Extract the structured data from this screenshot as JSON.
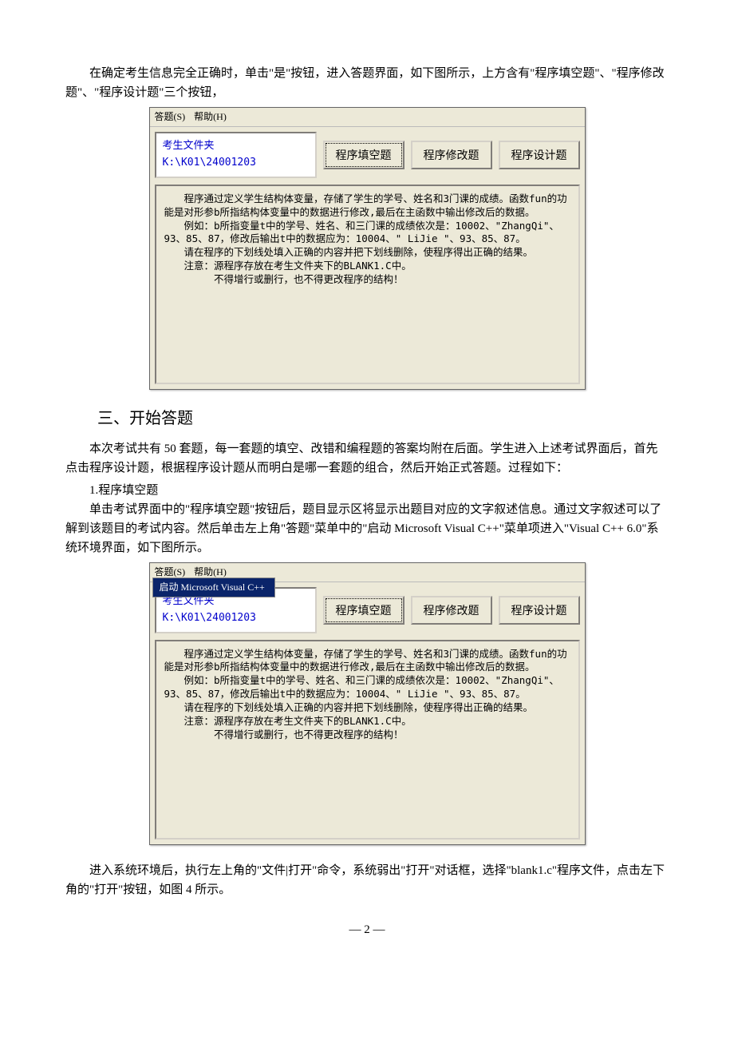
{
  "intro1": "在确定考生信息完全正确时，单击\"是\"按钮，进入答题界面，如下图所示，上方含有\"程序填空题\"、\"程序修改题\"、\"程序设计题\"三个按钮，",
  "menu": {
    "answer": "答题(S)",
    "help": "帮助(H)",
    "dropdown_label": "启动 Microsoft Visual C++"
  },
  "toolbar": {
    "path_label": "考生文件夹 K:\\K01\\24001203",
    "btn_fill": "程序填空题",
    "btn_modify": "程序修改题",
    "btn_design": "程序设计题"
  },
  "question": {
    "l1": "程序通过定义学生结构体变量，存储了学生的学号、姓名和3门课的成绩。函数fun的功能是对形参b所指结构体变量中的数据进行修改,最后在主函数中输出修改后的数据。",
    "l2": "例如：b所指变量t中的学号、姓名、和三门课的成绩依次是：10002、\"ZhangQi\"、93、85、87，修改后输出t中的数据应为：10004、\" LiJie \"、93、85、87。",
    "l3": "请在程序的下划线处填入正确的内容并把下划线删除，使程序得出正确的结果。",
    "l4": "注意：源程序存放在考生文件夹下的BLANK1.C中。",
    "l5": "不得增行或删行，也不得更改程序的结构！"
  },
  "section3_title": "三、开始答题",
  "para2": "本次考试共有 50 套题，每一套题的填空、改错和编程题的答案均附在后面。学生进入上述考试界面后，首先点击程序设计题，根据程序设计题从而明白是哪一套题的组合，然后开始正式答题。过程如下：",
  "sub1": "1.程序填空题",
  "para3": "单击考试界面中的\"程序填空题\"按钮后，题目显示区将显示出题目对应的文字叙述信息。通过文字叙述可以了解到该题目的考试内容。然后单击左上角\"答题\"菜单中的\"启动 Microsoft Visual C++\"菜单项进入\"Visual C++ 6.0\"系统环境界面，如下图所示。",
  "para4": "进入系统环境后，执行左上角的\"文件|打开\"命令，系统弱出\"打开\"对话框，选择\"blank1.c\"程序文件，点击左下角的\"打开\"按钮，如图 4 所示。",
  "page_num": "— 2 —"
}
